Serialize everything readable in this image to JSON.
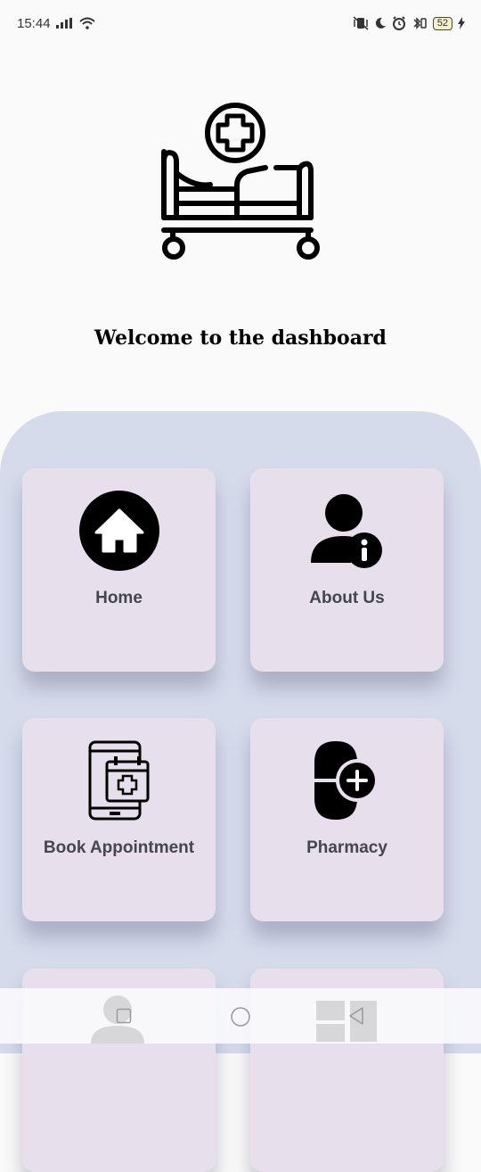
{
  "status": {
    "time": "15:44",
    "battery": "52"
  },
  "header": {
    "icon": "hospital-bed-icon",
    "welcome_text": "Welcome to the dashboard"
  },
  "cards": [
    {
      "label": "Home",
      "icon": "home-icon"
    },
    {
      "label": "About Us",
      "icon": "user-info-icon"
    },
    {
      "label": "Book Appointment",
      "icon": "phone-calendar-icon"
    },
    {
      "label": "Pharmacy",
      "icon": "capsule-plus-icon"
    }
  ],
  "colors": {
    "panel": "#d6dbec",
    "card": "#e7dfeb",
    "label": "#45454f"
  }
}
